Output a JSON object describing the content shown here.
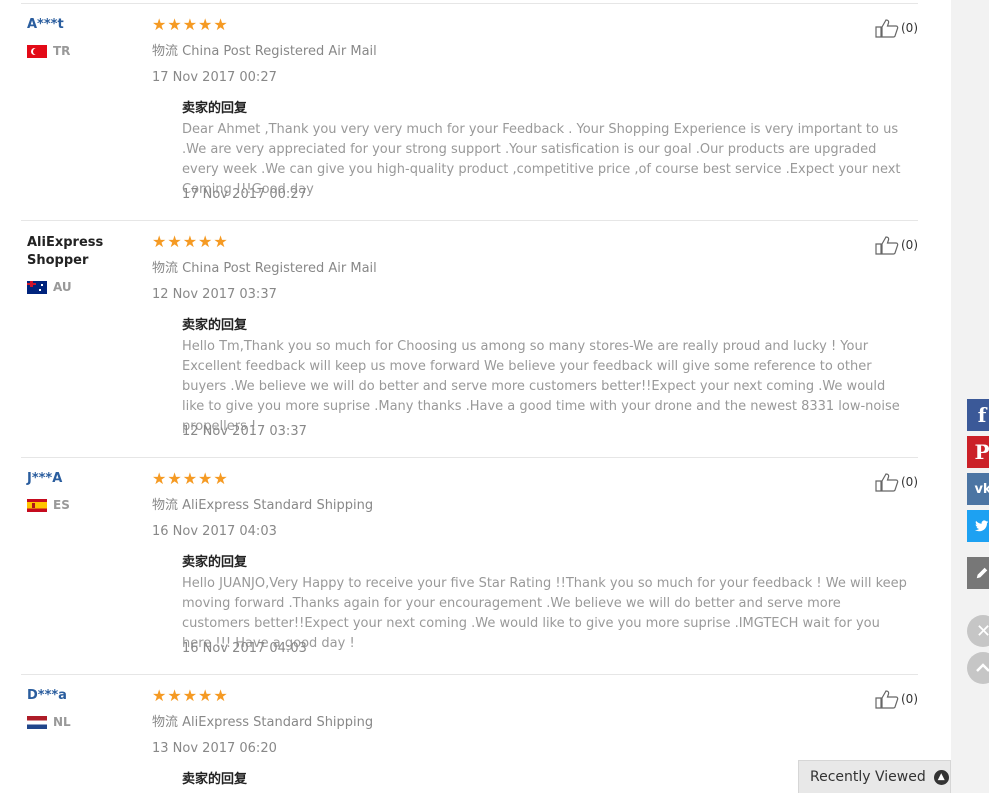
{
  "reply_heading": "卖家的回复",
  "shipping_prefix": "物流",
  "reviews": [
    {
      "buyer": "A***t",
      "country": "TR",
      "stars": 5,
      "shipping": "China Post Registered Air Mail",
      "date": "17 Nov 2017 00:27",
      "helpful": "(0)",
      "reply": "Dear Ahmet ,Thank you very very much for your Feedback . Your Shopping Experience is very important to us .We are very appreciated for your strong support .Your satisfication is our goal .Our products are upgraded every week .We can give you high-quality product ,competitive price ,of course best service .Expect your next Coming !!!Good day",
      "reply_date": "17 Nov 2017 00:27"
    },
    {
      "buyer": "AliExpress Shopper",
      "country": "AU",
      "stars": 5,
      "shipping": "China Post Registered Air Mail",
      "date": "12 Nov 2017 03:37",
      "helpful": "(0)",
      "reply": "Hello Tm,Thank you so much for Choosing us among so many stores-We are really proud and lucky ! Your Excellent feedback will keep us move forward We believe your feedback will give some reference to other buyers .We believe we will do better and serve more customers better!!Expect your next coming .We would like to give you more suprise .Many thanks .Have a good time with your drone and the newest 8331 low-noise propellers !",
      "reply_date": "12 Nov 2017 03:37"
    },
    {
      "buyer": "J***A",
      "country": "ES",
      "stars": 5,
      "shipping": "AliExpress Standard Shipping",
      "date": "16 Nov 2017 04:03",
      "helpful": "(0)",
      "reply": "Hello JUANJO,Very Happy to receive your five Star Rating !!Thank you so much for your feedback ! We will keep moving forward .Thanks again for your encouragement .We believe we will do better and serve more customers better!!Expect your next coming .We would like to give you more suprise .IMGTECH wait for you here !!! Have a good day !",
      "reply_date": "16 Nov 2017 04:03"
    },
    {
      "buyer": "D***a",
      "country": "NL",
      "stars": 5,
      "shipping": "AliExpress Standard Shipping",
      "date": "13 Nov 2017 06:20",
      "helpful": "(0)"
    }
  ],
  "share": {
    "facebook_glyph": "f",
    "pinterest_glyph": "P",
    "vk_glyph": "vk",
    "twitter_glyph": "t"
  },
  "recently_viewed": "Recently Viewed",
  "colors": {
    "star": "#f59a23",
    "buyer_link": "#2a5d9e",
    "facebook": "#3b5998",
    "pinterest": "#cb2027",
    "vk": "#4c75a3",
    "twitter": "#1da1f2",
    "edit": "#777777"
  }
}
